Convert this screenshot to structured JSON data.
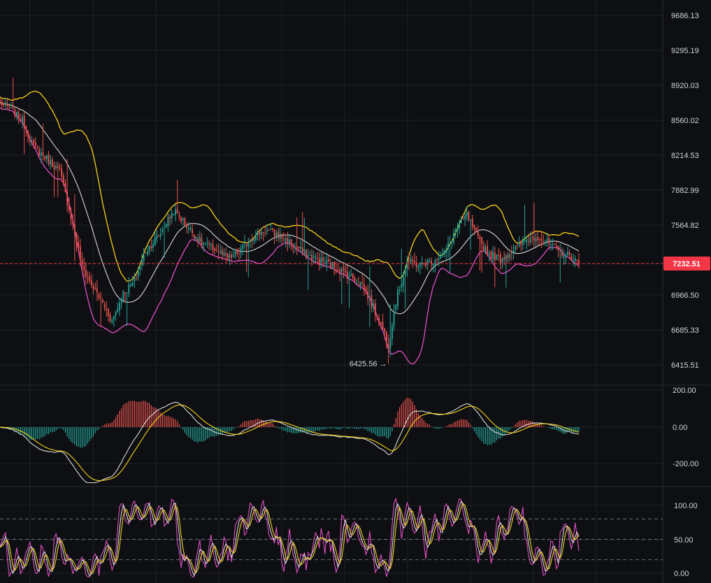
{
  "chart_data": [
    {
      "type": "candlestick",
      "panel": "price",
      "y_ticks": [
        "9686.13",
        "9295.19",
        "8920.03",
        "8560.02",
        "8214.53",
        "7882.99",
        "7564.82",
        "7232.51",
        "6966.50",
        "6685.33",
        "6415.51"
      ],
      "ylim": [
        6330,
        9800
      ],
      "last_price": 7232.51,
      "last_price_label": "7232.51",
      "last_price_color": "#f23645",
      "up_color": "#26a69a",
      "down_color": "#ef5350",
      "overlays": [
        {
          "id": "bb_upper",
          "color": "#f5d21b"
        },
        {
          "id": "bb_middle",
          "color": "#d9d9d9"
        },
        {
          "id": "bb_lower",
          "color": "#e04fc4"
        }
      ],
      "annotation": {
        "text": "6425.56 →",
        "value": 6425.56
      },
      "grid": true,
      "close_anchors": [
        [
          0,
          8740
        ],
        [
          5,
          8680
        ],
        [
          12,
          8560
        ],
        [
          18,
          8300
        ],
        [
          25,
          8180
        ],
        [
          32,
          8060
        ],
        [
          38,
          7640
        ],
        [
          44,
          7200
        ],
        [
          48,
          7080
        ],
        [
          55,
          6900
        ],
        [
          60,
          6760
        ],
        [
          66,
          6980
        ],
        [
          72,
          7080
        ],
        [
          78,
          7340
        ],
        [
          86,
          7500
        ],
        [
          93,
          7700
        ],
        [
          100,
          7560
        ],
        [
          108,
          7410
        ],
        [
          115,
          7360
        ],
        [
          122,
          7270
        ],
        [
          128,
          7330
        ],
        [
          135,
          7460
        ],
        [
          142,
          7520
        ],
        [
          150,
          7470
        ],
        [
          158,
          7380
        ],
        [
          165,
          7300
        ],
        [
          172,
          7260
        ],
        [
          180,
          7200
        ],
        [
          188,
          7120
        ],
        [
          194,
          7060
        ],
        [
          200,
          6860
        ],
        [
          205,
          6700
        ],
        [
          208,
          6570
        ],
        [
          212,
          6920
        ],
        [
          218,
          7250
        ],
        [
          225,
          7220
        ],
        [
          232,
          7260
        ],
        [
          238,
          7320
        ],
        [
          244,
          7520
        ],
        [
          250,
          7660
        ],
        [
          256,
          7440
        ],
        [
          262,
          7320
        ],
        [
          268,
          7270
        ],
        [
          275,
          7350
        ],
        [
          282,
          7440
        ],
        [
          288,
          7470
        ],
        [
          294,
          7400
        ],
        [
          300,
          7330
        ],
        [
          306,
          7290
        ],
        [
          310,
          7232.51
        ]
      ]
    },
    {
      "type": "macd",
      "panel": "macd",
      "y_ticks": [
        "200.00",
        "0.00",
        "-200.00"
      ],
      "ylim": [
        -320,
        240
      ],
      "fast_color": "#d9d9d9",
      "signal_color": "#f5d21b",
      "hist_up_color": "#ef5350",
      "hist_down_color": "#26a69a"
    },
    {
      "type": "stochastic",
      "panel": "oscillator",
      "y_ticks": [
        "100.00",
        "50.00",
        "0.00"
      ],
      "ylim": [
        -5,
        110
      ],
      "levels": [
        80,
        50,
        20
      ],
      "k_color": "#e04fc4",
      "d_color": "#d9d9d9",
      "signal_color": "#f5d21b"
    }
  ]
}
